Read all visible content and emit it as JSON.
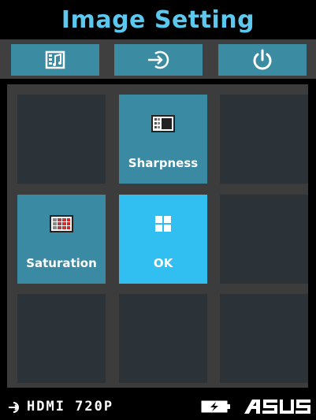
{
  "header": {
    "title": "Image Setting"
  },
  "topbar": {
    "buttons": [
      {
        "icon": "image-music-icon"
      },
      {
        "icon": "input-source-icon"
      },
      {
        "icon": "power-icon"
      }
    ]
  },
  "grid": {
    "tiles": [
      {
        "label": "",
        "state": "empty"
      },
      {
        "label": "Sharpness",
        "icon": "sharpness-icon",
        "state": "active"
      },
      {
        "label": "",
        "state": "empty"
      },
      {
        "label": "Saturation",
        "icon": "saturation-icon",
        "state": "active"
      },
      {
        "label": "OK",
        "icon": "ok-grid-icon",
        "state": "selected"
      },
      {
        "label": "",
        "state": "empty"
      },
      {
        "label": "",
        "state": "empty"
      },
      {
        "label": "",
        "state": "empty"
      },
      {
        "label": "",
        "state": "empty"
      }
    ]
  },
  "status": {
    "source": "HDMI  720P",
    "source_icon": "input-source-icon",
    "battery_icon": "battery-charging-icon",
    "brand": "ASUS"
  },
  "colors": {
    "title": "#5bc8f0",
    "tile_active": "#3a8aa4",
    "tile_selected": "#31bff2",
    "tile_empty": "#2b3338"
  }
}
